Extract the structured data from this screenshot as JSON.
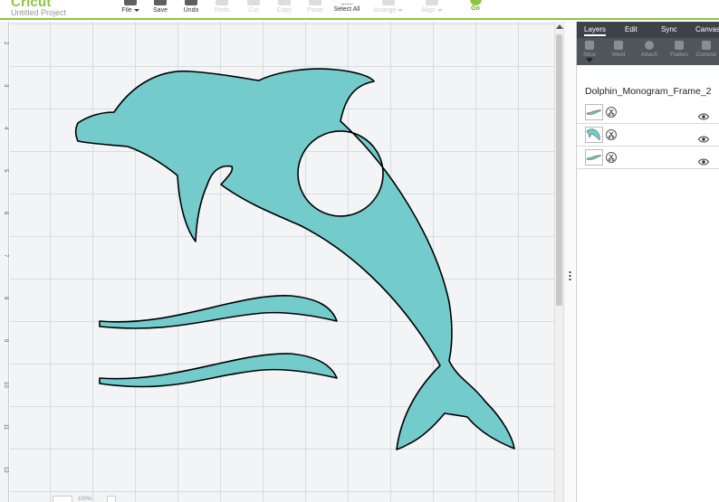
{
  "brand": "Cricut",
  "project_name": "Untitled Project",
  "toolbar": {
    "file": "File",
    "save": "Save",
    "undo": "Undo",
    "redo": "Redo",
    "cut": "Cut",
    "copy": "Copy",
    "paste": "Paste",
    "select_all": "Select All",
    "arrange": "Arrange",
    "align": "Align",
    "go": "Go"
  },
  "ruler": {
    "ticks": [
      "2",
      "3",
      "4",
      "5",
      "6",
      "7",
      "8",
      "9",
      "10",
      "11",
      "12"
    ]
  },
  "panel": {
    "tabs": [
      "Layers",
      "Edit",
      "Sync",
      "Canvas"
    ],
    "actions": [
      "Slice",
      "Weld",
      "Attach",
      "Flatten",
      "Contour"
    ],
    "group_name": "Dolphin_Monogram_Frame_2",
    "layers": [
      {
        "thumb": "wave-thumbnail"
      },
      {
        "thumb": "dolphin-thumbnail"
      },
      {
        "thumb": "wave-thumbnail"
      }
    ]
  },
  "zoom": {
    "level": "100%"
  },
  "colors": {
    "accent": "#8cc63f",
    "shape_fill": "#73cbcc",
    "panel_dark": "#3c4247"
  }
}
